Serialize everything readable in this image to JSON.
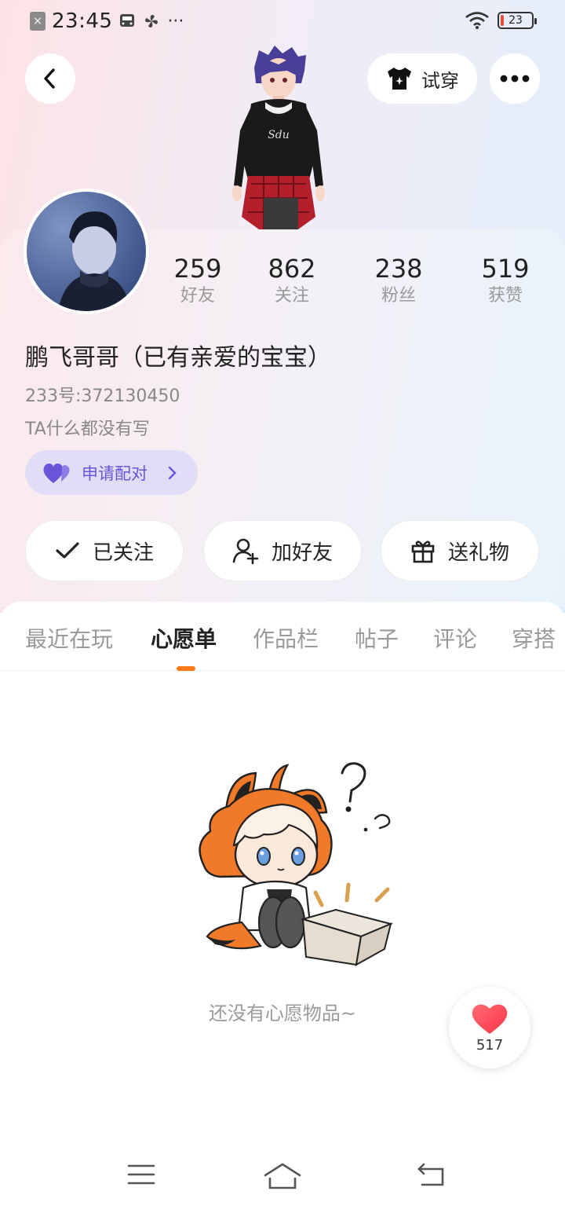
{
  "status_bar": {
    "time": "23:45",
    "battery": "23",
    "more": "···"
  },
  "header": {
    "tryon_label": "试穿"
  },
  "profile": {
    "stats": [
      {
        "value": "259",
        "label": "好友"
      },
      {
        "value": "862",
        "label": "关注"
      },
      {
        "value": "238",
        "label": "粉丝"
      },
      {
        "value": "519",
        "label": "获赞"
      }
    ],
    "username": "鹏飞哥哥（已有亲爱的宝宝）",
    "id_text": "233号:372130450",
    "bio": "TA什么都没有写",
    "pair_label": "申请配对"
  },
  "actions": {
    "following_label": "已关注",
    "add_friend_label": "加好友",
    "gift_label": "送礼物"
  },
  "tabs": [
    {
      "label": "最近在玩",
      "active": false
    },
    {
      "label": "心愿单",
      "active": true
    },
    {
      "label": "作品栏",
      "active": false
    },
    {
      "label": "帖子",
      "active": false
    },
    {
      "label": "评论",
      "active": false
    },
    {
      "label": "穿搭",
      "active": false
    }
  ],
  "wishlist": {
    "empty_text": "还没有心愿物品~"
  },
  "like": {
    "count": "517"
  },
  "colors": {
    "accent_orange": "#ff7a1a",
    "pair_purple": "#6a55d8",
    "heart_red": "#ff4a57"
  }
}
